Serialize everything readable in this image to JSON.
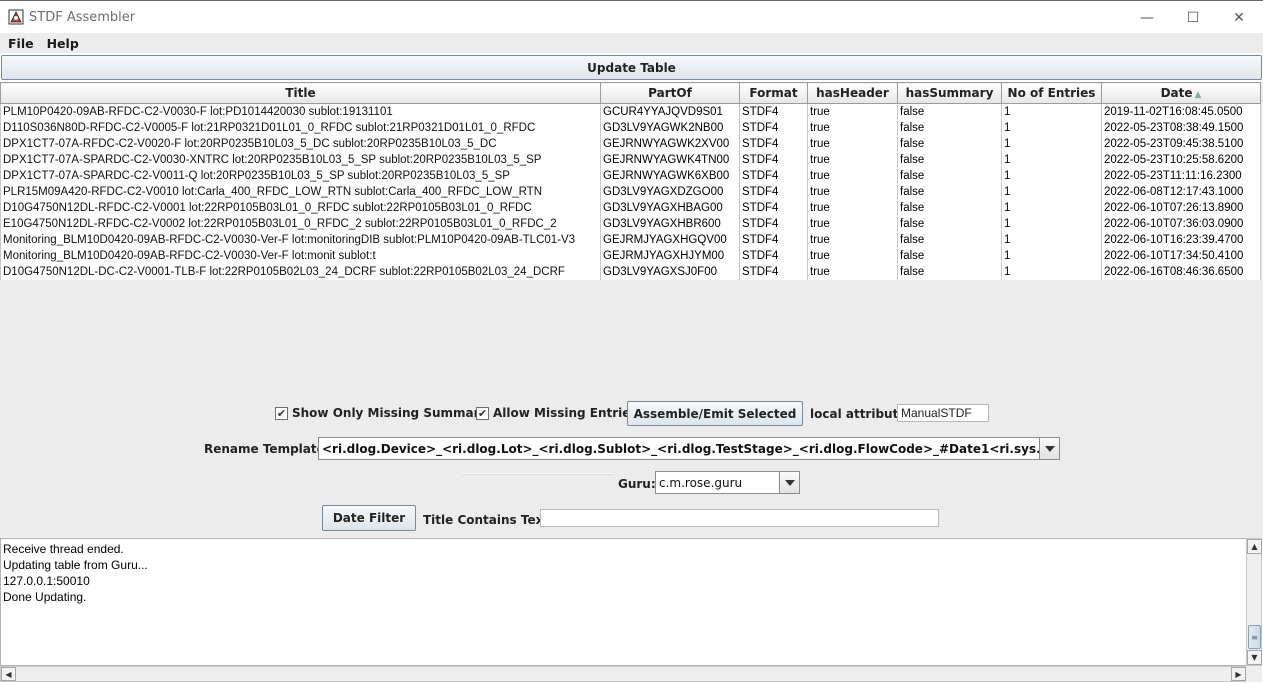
{
  "window": {
    "title": "STDF Assembler",
    "minimize": "—",
    "maximize": "☐",
    "close": "✕"
  },
  "menu": [
    "File",
    "Help"
  ],
  "toolbar": {
    "update_label": "Update Table"
  },
  "table": {
    "columns": [
      "Title",
      "PartOf",
      "Format",
      "hasHeader",
      "hasSummary",
      "No of Entries",
      "Date"
    ],
    "sort_column": "Date",
    "rows": [
      [
        "PLM10P0420-09AB-RFDC-C2-V0030-F lot:PD1014420030 sublot:19131101",
        "GCUR4YYAJQVD9S01",
        "STDF4",
        "true",
        "false",
        "1",
        "2019-11-02T16:08:45.0500"
      ],
      [
        "D110S036N80D-RFDC-C2-V0005-F lot:21RP0321D01L01_0_RFDC sublot:21RP0321D01L01_0_RFDC",
        "GD3LV9YAGWK2NB00",
        "STDF4",
        "true",
        "false",
        "1",
        "2022-05-23T08:38:49.1500"
      ],
      [
        "DPX1CT7-07A-RFDC-C2-V0020-F lot:20RP0235B10L03_5_DC sublot:20RP0235B10L03_5_DC",
        "GEJRNWYAGWK2XV00",
        "STDF4",
        "true",
        "false",
        "1",
        "2022-05-23T09:45:38.5100"
      ],
      [
        "DPX1CT7-07A-SPARDC-C2-V0030-XNTRC lot:20RP0235B10L03_5_SP sublot:20RP0235B10L03_5_SP",
        "GEJRNWYAGWK4TN00",
        "STDF4",
        "true",
        "false",
        "1",
        "2022-05-23T10:25:58.6200"
      ],
      [
        "DPX1CT7-07A-SPARDC-C2-V0011-Q lot:20RP0235B10L03_5_SP sublot:20RP0235B10L03_5_SP",
        "GEJRNWYAGWK6XB00",
        "STDF4",
        "true",
        "false",
        "1",
        "2022-05-23T11:11:16.2300"
      ],
      [
        "PLR15M09A420-RFDC-C2-V0010 lot:Carla_400_RFDC_LOW_RTN sublot:Carla_400_RFDC_LOW_RTN",
        "GD3LV9YAGXDZGO00",
        "STDF4",
        "true",
        "false",
        "1",
        "2022-06-08T12:17:43.1000"
      ],
      [
        "D10G4750N12DL-RFDC-C2-V0001 lot:22RP0105B03L01_0_RFDC sublot:22RP0105B03L01_0_RFDC",
        "GD3LV9YAGXHBAG00",
        "STDF4",
        "true",
        "false",
        "1",
        "2022-06-10T07:26:13.8900"
      ],
      [
        "E10G4750N12DL-RFDC-C2-V0002 lot:22RP0105B03L01_0_RFDC_2 sublot:22RP0105B03L01_0_RFDC_2",
        "GD3LV9YAGXHBR600",
        "STDF4",
        "true",
        "false",
        "1",
        "2022-06-10T07:36:03.0900"
      ],
      [
        "Monitoring_BLM10D0420-09AB-RFDC-C2-V0030-Ver-F lot:monitoringDIB sublot:PLM10P0420-09AB-TLC01-V3",
        "GEJRMJYAGXHGQV00",
        "STDF4",
        "true",
        "false",
        "1",
        "2022-06-10T16:23:39.4700"
      ],
      [
        "Monitoring_BLM10D0420-09AB-RFDC-C2-V0030-Ver-F lot:monit sublot:t",
        "GEJRMJYAGXHJYM00",
        "STDF4",
        "true",
        "false",
        "1",
        "2022-06-10T17:34:50.4100"
      ],
      [
        "D10G4750N12DL-DC-C2-V0001-TLB-F lot:22RP0105B02L03_24_DCRF sublot:22RP0105B02L03_24_DCRF",
        "GD3LV9YAGXSJ0F00",
        "STDF4",
        "true",
        "false",
        "1",
        "2022-06-16T08:46:36.6500"
      ]
    ]
  },
  "controls": {
    "show_only_missing_summary": {
      "label": "Show Only Missing Summary",
      "checked": true
    },
    "allow_missing_entries": {
      "label": "Allow Missing Entries",
      "checked": true
    },
    "assemble_label": "Assemble/Emit Selected",
    "local_attribute_label": "local attribute:",
    "local_attribute_value": "ManualSTDF",
    "rename_template_label": "Rename Template:",
    "rename_template_value": "<ri.dlog.Device>_<ri.dlog.Lot>_<ri.dlog.Sublot>_<ri.dlog.TestStage>_<ri.dlog.FlowCode>_#Date1<ri.sys.CreationDate>.stdf",
    "guru_label": "Guru:",
    "guru_value": "c.m.rose.guru",
    "date_filter_label": "Date Filter",
    "title_contains_label": "Title Contains Text:",
    "title_contains_value": ""
  },
  "log": [
    "Receive thread ended.",
    "Updating table from Guru...",
    "127.0.0.1:50010",
    "Done Updating."
  ]
}
